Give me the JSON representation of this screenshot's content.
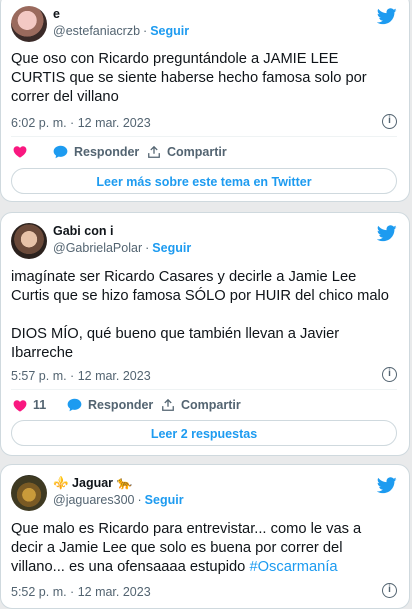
{
  "follow_label": "Seguir",
  "tweets": [
    {
      "name": "e",
      "handle": "@estefaniacrzb",
      "text": "Que oso con Ricardo preguntándole a JAMIE LEE CURTIS que se siente haberse hecho famosa solo por correr del villano",
      "time": "6:02 p. m. · 12 mar. 2023",
      "likes": "",
      "reply_label": "Responder",
      "share_label": "Compartir",
      "cta": "Leer más sobre este tema en Twitter"
    },
    {
      "name": "Gabi con i",
      "handle": "@GabrielaPolar",
      "text": "imagínate ser Ricardo Casares y decirle a Jamie Lee Curtis que se hizo famosa SÓLO por HUIR del chico malo\n\nDIOS MÍO, qué bueno que también llevan a Javier Ibarreche",
      "time": "5:57 p. m. · 12 mar. 2023",
      "likes": "11",
      "reply_label": "Responder",
      "share_label": "Compartir",
      "cta": "Leer 2 respuestas"
    },
    {
      "name": "⚜️ Jaguar 🐆",
      "handle": "@jaguares300",
      "text": "Que malo es Ricardo para entrevistar... como le vas a decir a Jamie Lee que solo es buena por correr del villano... es una ofensaaaa estupido ",
      "hashtag": "#Oscarmanía",
      "time": "5:52 p. m. · 12 mar. 2023"
    }
  ],
  "colors": {
    "accent": "#1d9bf0",
    "like": "#f91880",
    "muted": "#536471"
  },
  "icons": {
    "brand": "twitter-bird-icon",
    "like": "heart-icon",
    "reply": "speech-bubble-icon",
    "share": "share-arrow-icon",
    "info": "info-icon"
  }
}
